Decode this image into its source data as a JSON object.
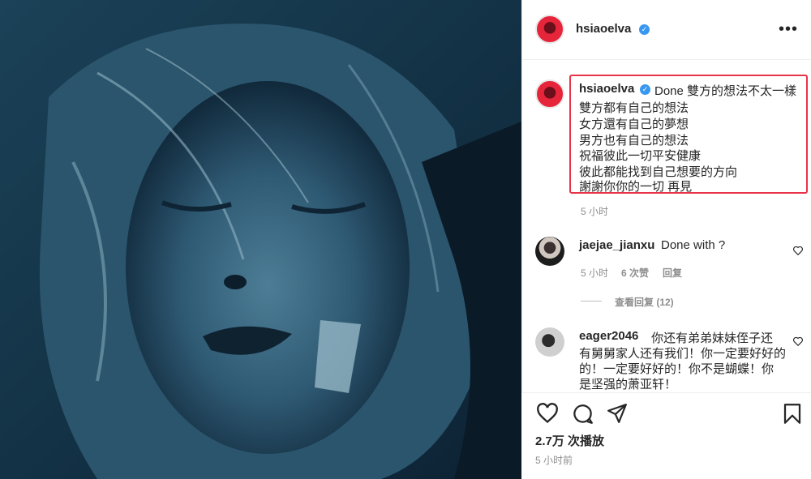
{
  "post": {
    "username": "hsiaoelva",
    "verified": true,
    "more_icon": "more-horizontal-icon"
  },
  "caption": {
    "username": "hsiaoelva",
    "lines": [
      "Done 雙方的想法不太一樣",
      "雙方都有自己的想法",
      "女方還有自己的夢想",
      "男方也有自己的想法",
      "祝福彼此一切平安健康",
      "彼此都能找到自己想要的方向",
      "謝謝你你的一切 再見"
    ],
    "time": "5 小时",
    "highlight_color": "#e8344a"
  },
  "comments": [
    {
      "username": "jaejae_jianxu",
      "text": "Done with ?",
      "time": "5 小时",
      "likes": "6 次赞",
      "reply": "回复",
      "view_replies": "查看回复 (12)"
    },
    {
      "username": "eager2046",
      "text_lines": [
        "你还有弟弟妹妹侄子还",
        "有舅舅家人还有我们！你一定要好好的",
        "的！一定要好好的！你不是蝴蝶！你",
        "是坚强的萧亚轩！"
      ]
    }
  ],
  "actions": {
    "views": "2.7万 次播放",
    "time": "5 小时前"
  },
  "colors": {
    "verified_blue": "#3897f0",
    "media_tint": "#16344a"
  }
}
